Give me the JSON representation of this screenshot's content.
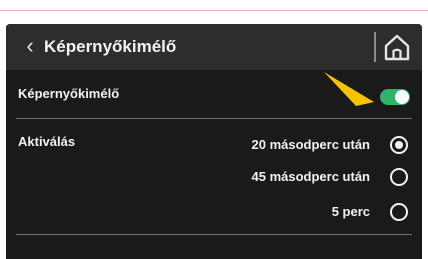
{
  "header": {
    "title": "Képernyőkimélő",
    "back_icon": "chevron-left-icon",
    "home_icon": "home-icon"
  },
  "screensaver": {
    "label": "Képernyőkimélő",
    "enabled": true,
    "toggle_color": "#2fb469"
  },
  "activation": {
    "label": "Aktiválás",
    "options": [
      {
        "label": "20 másodperc után",
        "selected": true
      },
      {
        "label": "45 másodperc után",
        "selected": false
      },
      {
        "label": "5 perc",
        "selected": false
      }
    ]
  },
  "annotation": {
    "arrow_icon": "arrow-pointer-icon",
    "arrow_color": "#f5c400"
  }
}
